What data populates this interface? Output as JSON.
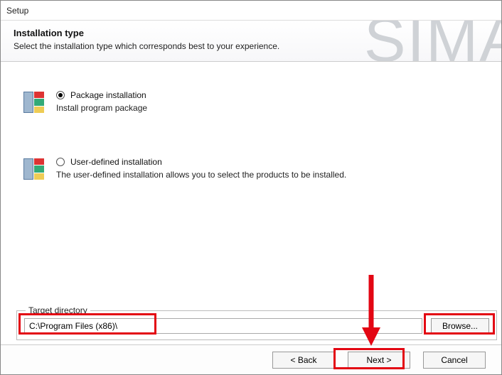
{
  "window": {
    "title": "Setup"
  },
  "header": {
    "title": "Installation type",
    "subtitle": "Select the installation type which corresponds best to your experience.",
    "brand_bg": "SIMA"
  },
  "options": {
    "package": {
      "label": "Package installation",
      "desc": "Install program package",
      "selected": true
    },
    "user": {
      "label": "User-defined installation",
      "desc": "The user-defined installation allows you to select the products to be installed.",
      "selected": false
    }
  },
  "target": {
    "legend": "Target directory",
    "path": "C:\\Program Files (x86)\\",
    "browse": "Browse..."
  },
  "footer": {
    "back": "< Back",
    "next": "Next >",
    "cancel": "Cancel"
  }
}
